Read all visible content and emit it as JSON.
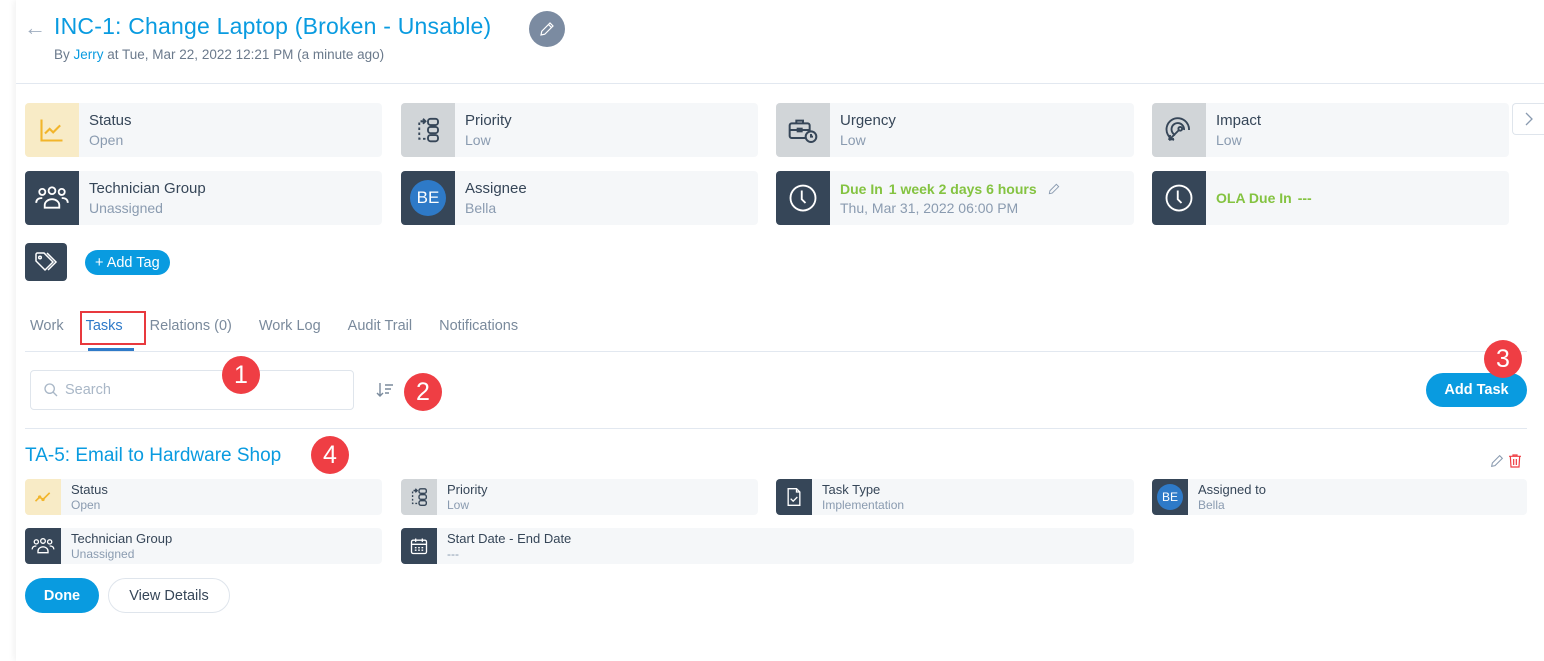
{
  "header": {
    "title": "INC-1: Change Laptop (Broken - Unsable)",
    "by_prefix": "By ",
    "author": "Jerry",
    "timestamp": " at Tue, Mar 22, 2022 12:21 PM (a minute ago)"
  },
  "info_cards": {
    "status": {
      "label": "Status",
      "value": "Open",
      "icon": "trend-chart-icon"
    },
    "priority": {
      "label": "Priority",
      "value": "Low",
      "icon": "priority-flow-icon"
    },
    "urgency": {
      "label": "Urgency",
      "value": "Low",
      "icon": "briefcase-clock-icon"
    },
    "impact": {
      "label": "Impact",
      "value": "Low",
      "icon": "target-cursor-icon"
    },
    "technician_group": {
      "label": "Technician Group",
      "value": "Unassigned",
      "icon": "users-icon"
    },
    "assignee": {
      "label": "Assignee",
      "value": "Bella",
      "initials": "BE"
    },
    "due": {
      "label": "Due In",
      "value": "1 week 2 days 6 hours",
      "date": "Thu, Mar 31, 2022 06:00 PM"
    },
    "ola_due": {
      "label": "OLA Due In",
      "value": "---"
    }
  },
  "tags": {
    "add_label": "+ Add Tag"
  },
  "tabs": [
    {
      "label": "Work"
    },
    {
      "label": "Tasks",
      "active": true
    },
    {
      "label": "Relations (0)"
    },
    {
      "label": "Work Log"
    },
    {
      "label": "Audit Trail"
    },
    {
      "label": "Notifications"
    }
  ],
  "toolbar": {
    "search_placeholder": "Search",
    "add_task_label": "Add Task"
  },
  "annotations": [
    "1",
    "2",
    "3",
    "4"
  ],
  "task": {
    "title": "TA-5: Email to Hardware Shop",
    "fields": {
      "status": {
        "label": "Status",
        "value": "Open"
      },
      "priority": {
        "label": "Priority",
        "value": "Low"
      },
      "task_type": {
        "label": "Task Type",
        "value": "Implementation"
      },
      "assigned_to": {
        "label": "Assigned to",
        "value": "Bella",
        "initials": "BE"
      },
      "technician_group": {
        "label": "Technician Group",
        "value": "Unassigned"
      },
      "dates": {
        "label": "Start Date - End Date",
        "value": "---"
      }
    },
    "done_label": "Done",
    "view_details_label": "View Details"
  },
  "colors": {
    "accent": "#099be0",
    "dark": "#364658",
    "due_green": "#84c341",
    "badge_red": "#ef3e44"
  }
}
